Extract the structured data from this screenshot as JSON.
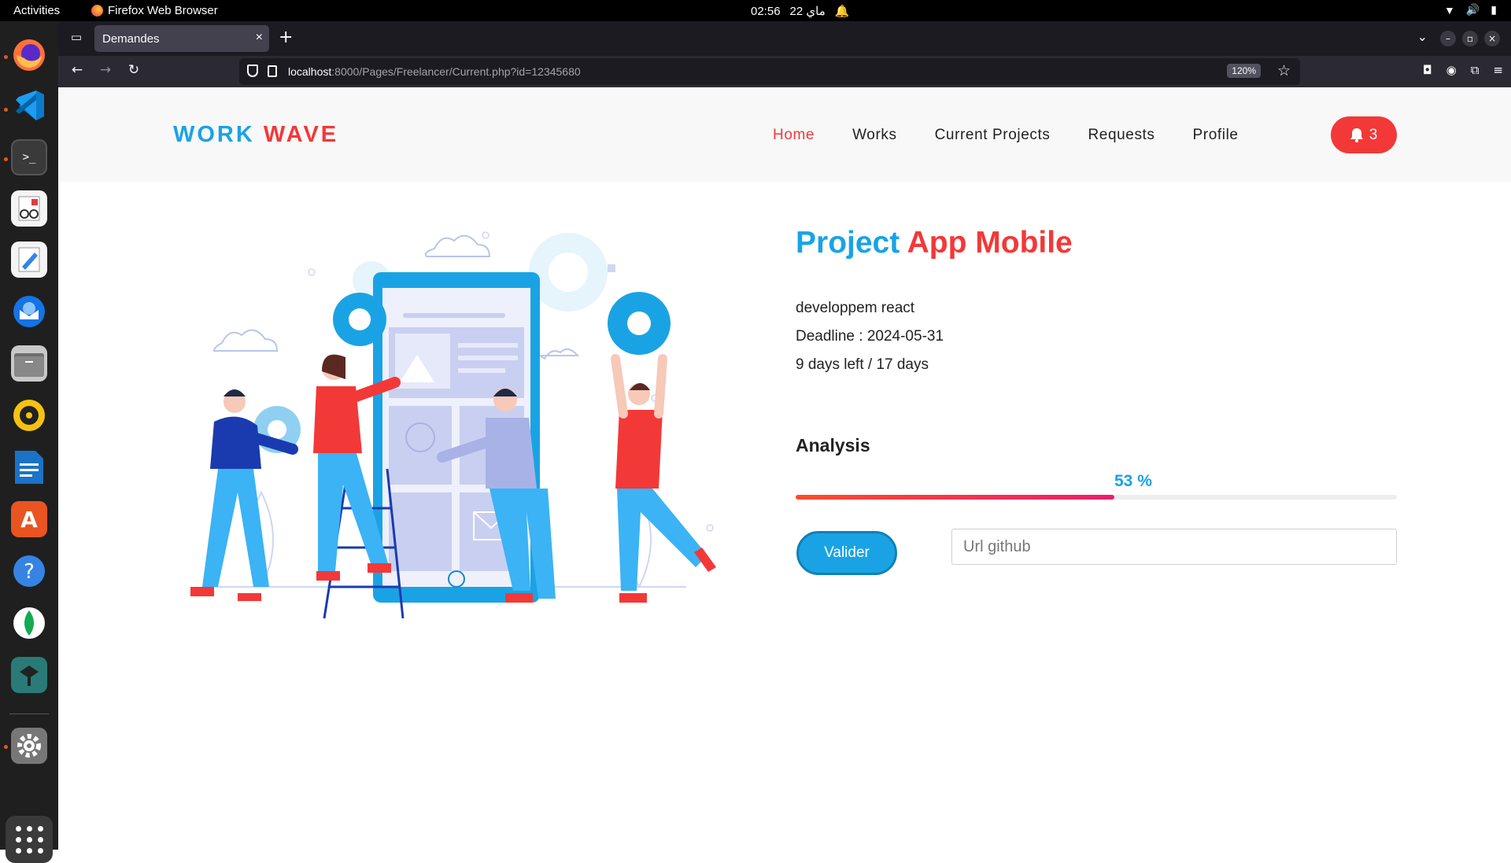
{
  "system_bar": {
    "activities": "Activities",
    "app_name": "Firefox Web Browser",
    "time": "02:56",
    "date": "ماي 22"
  },
  "browser": {
    "tab_title": "Demandes",
    "url_host": "localhost",
    "url_path": ":8000/Pages/Freelancer/Current.php?id=12345680",
    "zoom": "120%"
  },
  "site": {
    "logo_part1": "WORK",
    "logo_part2": "WAVE",
    "nav": {
      "home": "Home",
      "works": "Works",
      "current": "Current Projects",
      "requests": "Requests",
      "profile": "Profile"
    },
    "notification_count": "3"
  },
  "project": {
    "title_part1": "Project",
    "title_part2": "App Mobile",
    "description": "developpem react",
    "deadline": "Deadline : 2024-05-31",
    "days": "9 days left / 17 days",
    "analysis_label": "Analysis",
    "progress_label": "53 %",
    "progress": 0.53,
    "submit_label": "Valider",
    "github_placeholder": "Url github"
  },
  "colors": {
    "brand_blue": "#1aa3e4",
    "brand_red": "#f33838"
  },
  "dock_icons": [
    "firefox-icon",
    "vscode-icon",
    "terminal-icon",
    "document-viewer-icon",
    "text-editor-icon",
    "thunderbird-icon",
    "files-icon",
    "rhythmbox-icon",
    "libreoffice-writer-icon",
    "app-center-icon",
    "help-icon",
    "mongodb-compass-icon",
    "mysql-workbench-icon",
    "settings-icon",
    "show-apps-icon"
  ]
}
